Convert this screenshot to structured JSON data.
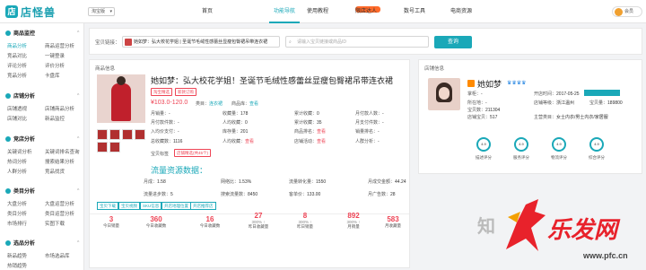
{
  "header": {
    "logo_text": "店怪兽",
    "platform": "淘宝版",
    "nav": [
      "首页",
      "功能导航",
      "使用教程",
      "限店达人",
      "数号工具",
      "电商资源"
    ],
    "user": "会员"
  },
  "sidebar": [
    {
      "title": "商品监控",
      "items": [
        [
          "商品分析",
          "商品运营分析"
        ],
        [
          "竞品对比",
          "一键登录"
        ],
        [
          "评论分析",
          "评价分析"
        ],
        [
          "竞品分析",
          "卡盘库"
        ]
      ]
    },
    {
      "title": "店铺分析",
      "items": [
        [
          "店铺透视",
          "店铺商品分析"
        ],
        [
          "店铺对比",
          "新品监控"
        ]
      ]
    },
    {
      "title": "竞店分析",
      "items": [
        [
          "关键词分析",
          "关键词排名查询"
        ],
        [
          "热词分析",
          "搜索结果分析"
        ],
        [
          "人群分析",
          "竞品找货"
        ]
      ]
    },
    {
      "title": "类目分析",
      "items": [
        [
          "大盘分析",
          "大盘运营分析"
        ],
        [
          "类目分析",
          "类目运营分析"
        ],
        [
          "市场排行",
          "实图下载"
        ]
      ]
    },
    {
      "title": "选品分析",
      "items": [
        [
          "新品趋势",
          "市场选品库"
        ],
        [
          "热销趋势",
          ""
        ]
      ]
    }
  ],
  "search": {
    "label": "宝贝链接：",
    "product_value": "她如梦：弘大校花学姐 | 圣诞节毛绒性感蕾丝显瘦包臀裙吊带连衣裙",
    "placeholder": "请输入宝贝链接或商品ID",
    "button": "查询"
  },
  "product": {
    "section_title": "商品信息",
    "name": "她如梦：弘大校花学姐！圣诞节毛绒性感蕾丝显瘦包臀裙吊带连衣裙",
    "tags": [
      "淘宝精选",
      "新款订购"
    ],
    "price": "¥103.0-120.0",
    "category_label": "类目：",
    "category": "连衣裙",
    "brand_label": "商品库：",
    "brand": "查看",
    "fields": [
      [
        "月销量：",
        "-"
      ],
      [
        "收藏量：",
        "178"
      ],
      [
        "累计收藏：",
        "0"
      ],
      [
        "月付款人数：",
        "-"
      ],
      [
        "月付款件数：",
        "-"
      ],
      [
        "人均收藏：",
        "0"
      ],
      [
        "累计收藏：",
        "35"
      ],
      [
        "月支付件数：",
        "-"
      ],
      [
        "入均价支付：",
        "-"
      ],
      [
        "库存量：",
        "201"
      ],
      [
        "商品排名：",
        "查看"
      ],
      [
        "销量排名：",
        "-"
      ],
      [
        "总收藏数：",
        "1116"
      ],
      [
        "人均收藏：",
        "查看"
      ],
      [
        "店铺活动：",
        "查看"
      ],
      [
        "人群分析：",
        "-"
      ]
    ],
    "detail_label": "宝贝标签",
    "detail_tag": "店铺精选(共45个)"
  },
  "conversion": {
    "title": "流量资源数据：",
    "rows": [
      [
        "月成：",
        "1.58",
        "网络比：",
        "1.53%",
        "流量转化量：",
        "1550",
        "月成交金额：",
        "44.24"
      ],
      [
        "流量进步数：",
        "5",
        "搜索流量数：",
        "8450",
        "客单价：",
        "133.00",
        "月广告数：",
        "28"
      ]
    ],
    "buttons": [
      "宝贝下载",
      "宝贝视频",
      "SKU信息",
      "开店地理位置",
      "开店推荐店"
    ]
  },
  "stats": [
    {
      "value": "3",
      "label": "今日销量",
      "delta": ""
    },
    {
      "value": "360",
      "label": "今日收藏数",
      "delta": ""
    },
    {
      "value": "16",
      "label": "今日收藏数",
      "delta": ""
    },
    {
      "value": "27",
      "label": "昨日收藏量",
      "delta": "300% ↑"
    },
    {
      "value": "8",
      "label": "昨日销量",
      "delta": "300% ↑"
    },
    {
      "value": "892",
      "label": "月销量",
      "delta": "300% ↑"
    },
    {
      "value": "583",
      "label": "月收藏量",
      "delta": ""
    }
  ],
  "shop": {
    "section_title": "店铺信息",
    "name": "她如梦",
    "fields": [
      [
        "掌柜：",
        "-"
      ],
      [
        "开店时间：",
        "2017-05-25"
      ],
      [
        "所在地：",
        "-"
      ],
      [
        "店铺等级：",
        "浙江温州"
      ],
      [
        "宝贝数：",
        "211304"
      ],
      [
        "宝贝量：",
        "189800"
      ],
      [
        "店铺宝贝：",
        "517"
      ],
      [
        "主营类目：",
        "女士内衣/男士内衣/家居服"
      ]
    ],
    "scores": [
      {
        "value": "4.9",
        "label": "描述评分"
      },
      {
        "value": "4.9",
        "label": "服务评分"
      },
      {
        "value": "4.9",
        "label": "物流评分"
      },
      {
        "value": "4.9",
        "label": "综合评分"
      }
    ]
  },
  "watermark": {
    "brand": "乐发网",
    "url": "www.pfc.cn",
    "sub": "知"
  }
}
